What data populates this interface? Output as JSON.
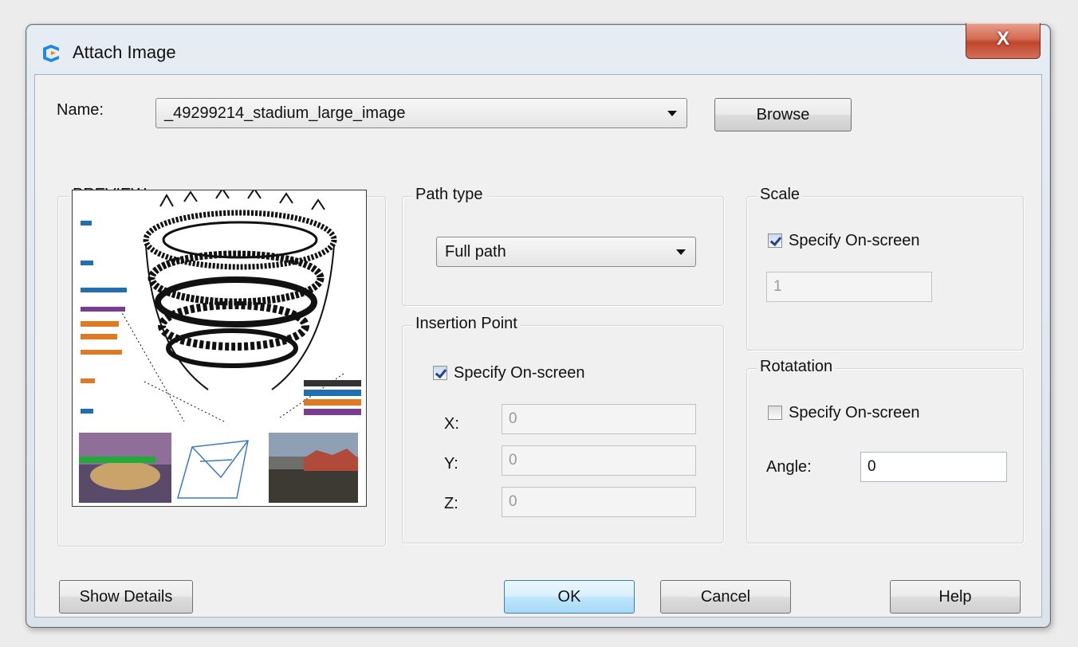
{
  "window": {
    "title": "Attach Image",
    "close_label": "X"
  },
  "name_row": {
    "label": "Name:",
    "selected_value": "_49299214_stadium_large_image",
    "browse_label": "Browse"
  },
  "preview": {
    "title": "PREVIEW"
  },
  "path_type": {
    "title": "Path type",
    "selected_value": "Full path"
  },
  "insertion_point": {
    "title": "Insertion Point",
    "specify_label": "Specify On-screen",
    "specify_checked": true,
    "x_label": "X:",
    "x_value": "0",
    "y_label": "Y:",
    "y_value": "0",
    "z_label": "Z:",
    "z_value": "0"
  },
  "scale": {
    "title": "Scale",
    "specify_label": "Specify On-screen",
    "specify_checked": true,
    "value": "1"
  },
  "rotation": {
    "title": "Rotatation",
    "specify_label": "Specify On-screen",
    "specify_checked": false,
    "angle_label": "Angle:",
    "angle_value": "0"
  },
  "buttons": {
    "show_details": "Show Details",
    "ok": "OK",
    "cancel": "Cancel",
    "help": "Help"
  },
  "colors": {
    "accent_blue": "#1e88e5",
    "close_red": "#c94a33",
    "default_button_border": "#3c7fb1"
  },
  "icons": {
    "app": "app-logo-icon",
    "dropdown": "chevron-down-icon",
    "check": "checkmark-icon"
  }
}
